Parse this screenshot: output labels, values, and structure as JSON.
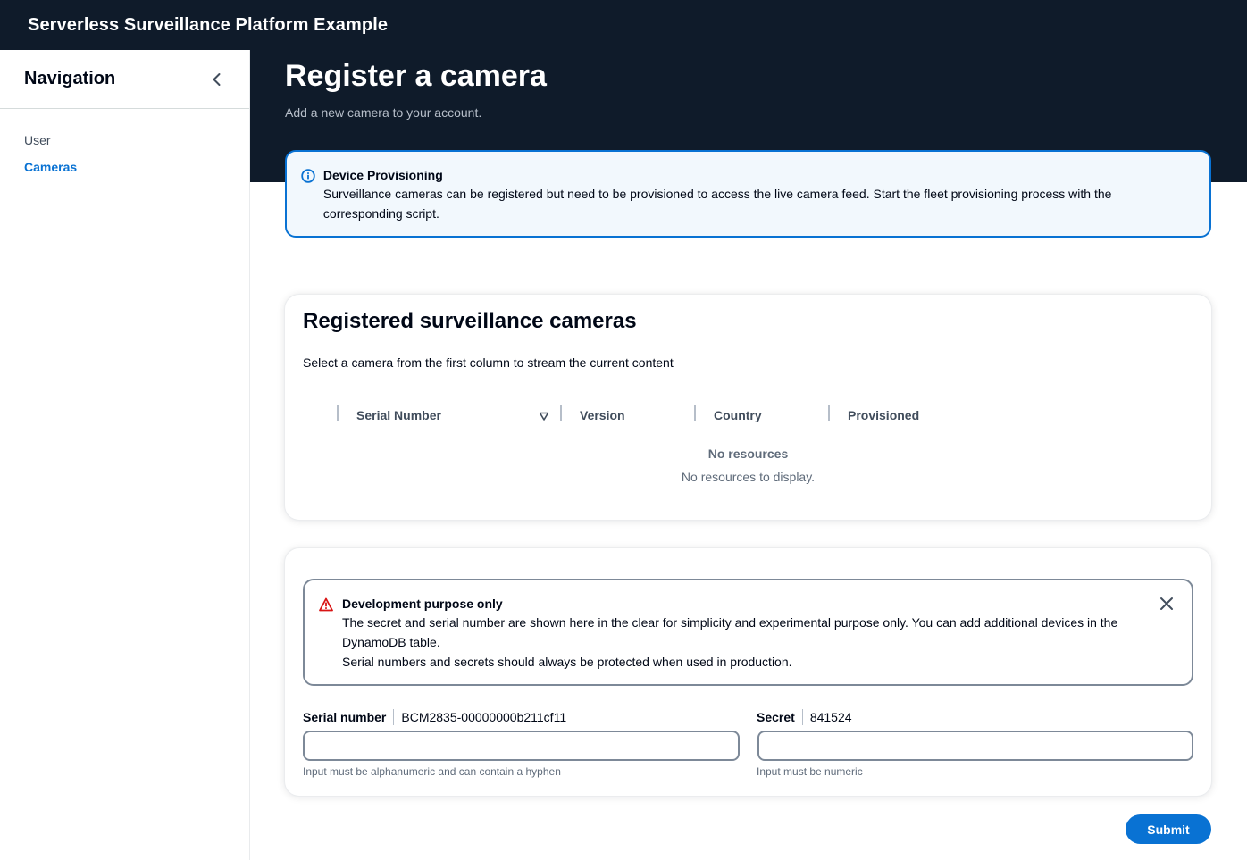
{
  "app": {
    "title": "Serverless Surveillance Platform Example"
  },
  "sidebar": {
    "title": "Navigation",
    "collapse_icon": "chevron-left-icon",
    "items": [
      {
        "label": "User",
        "active": false
      },
      {
        "label": "Cameras",
        "active": true
      }
    ]
  },
  "page": {
    "title": "Register a camera",
    "description": "Add a new camera to your account."
  },
  "info_alert": {
    "icon": "info-icon",
    "heading": "Device Provisioning",
    "body": "Surveillance cameras can be registered but need to be provisioned to access the live camera feed. Start the fleet provisioning process with the corresponding script."
  },
  "cameras_table": {
    "title": "Registered surveillance cameras",
    "description": "Select a camera from the first column to stream the current content",
    "columns": [
      "Serial Number",
      "Version",
      "Country",
      "Provisioned"
    ],
    "sort_icon": "sort-descending-icon",
    "rows": [],
    "empty_title": "No resources",
    "empty_description": "No resources to display."
  },
  "warning_alert": {
    "icon": "warning-icon",
    "heading": "Development purpose only",
    "body_line1": "The secret and serial number are shown here in the clear for simplicity and experimental purpose only. You can add additional devices in the DynamoDB table.",
    "body_line2": "Serial numbers and secrets should always be protected when used in production.",
    "dismiss_icon": "close-icon"
  },
  "form": {
    "serial": {
      "label": "Serial number",
      "info": "BCM2835-00000000b211cf11",
      "value": "",
      "hint": "Input must be alphanumeric and can contain a hyphen"
    },
    "secret": {
      "label": "Secret",
      "info": "841524",
      "value": "",
      "hint": "Input must be numeric"
    },
    "submit_label": "Submit"
  },
  "colors": {
    "header_bg": "#0f1b2a",
    "accent": "#0972d3",
    "info_bg": "#f2f8fd",
    "warning": "#d91515"
  }
}
